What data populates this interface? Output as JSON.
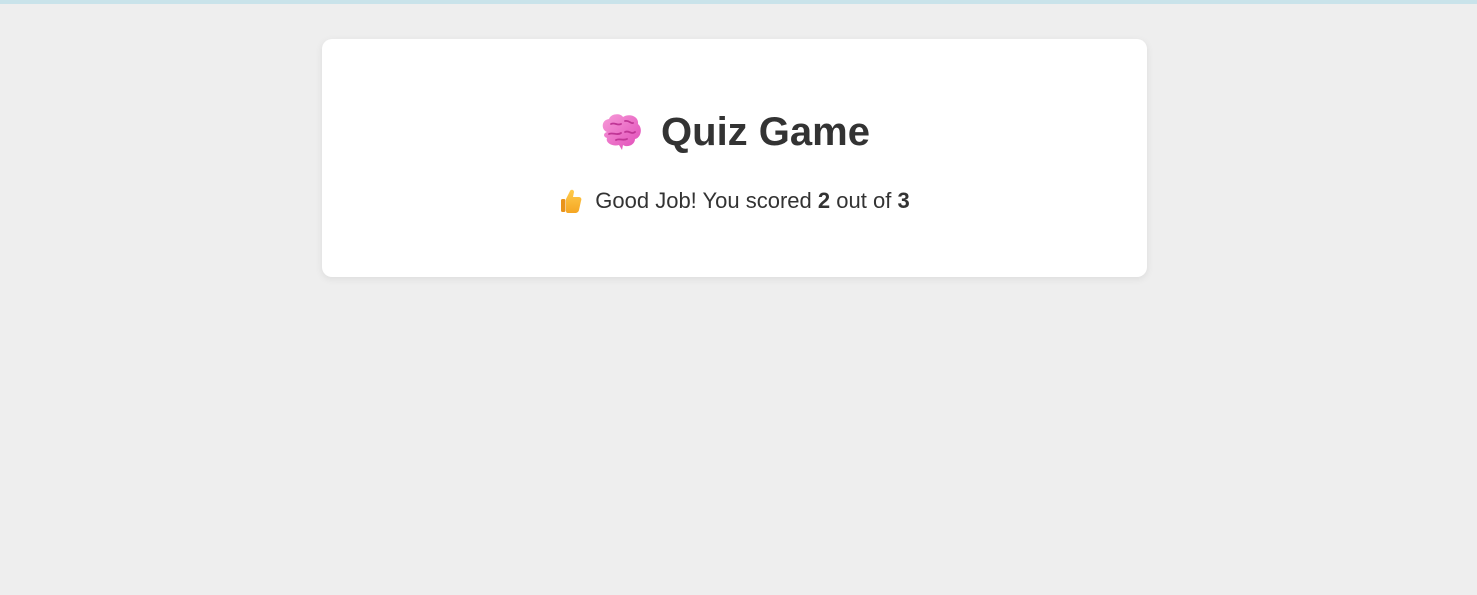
{
  "colors": {
    "background": "#eeeeee",
    "card": "#ffffff",
    "text": "#333333",
    "top_strip": "#c9e3ea"
  },
  "header": {
    "icon": "brain-icon",
    "title": "Quiz Game"
  },
  "result": {
    "icon": "thumbs-up-icon",
    "message_prefix": "Good Job! You scored",
    "score": "2",
    "between": "out of",
    "total": "3"
  }
}
